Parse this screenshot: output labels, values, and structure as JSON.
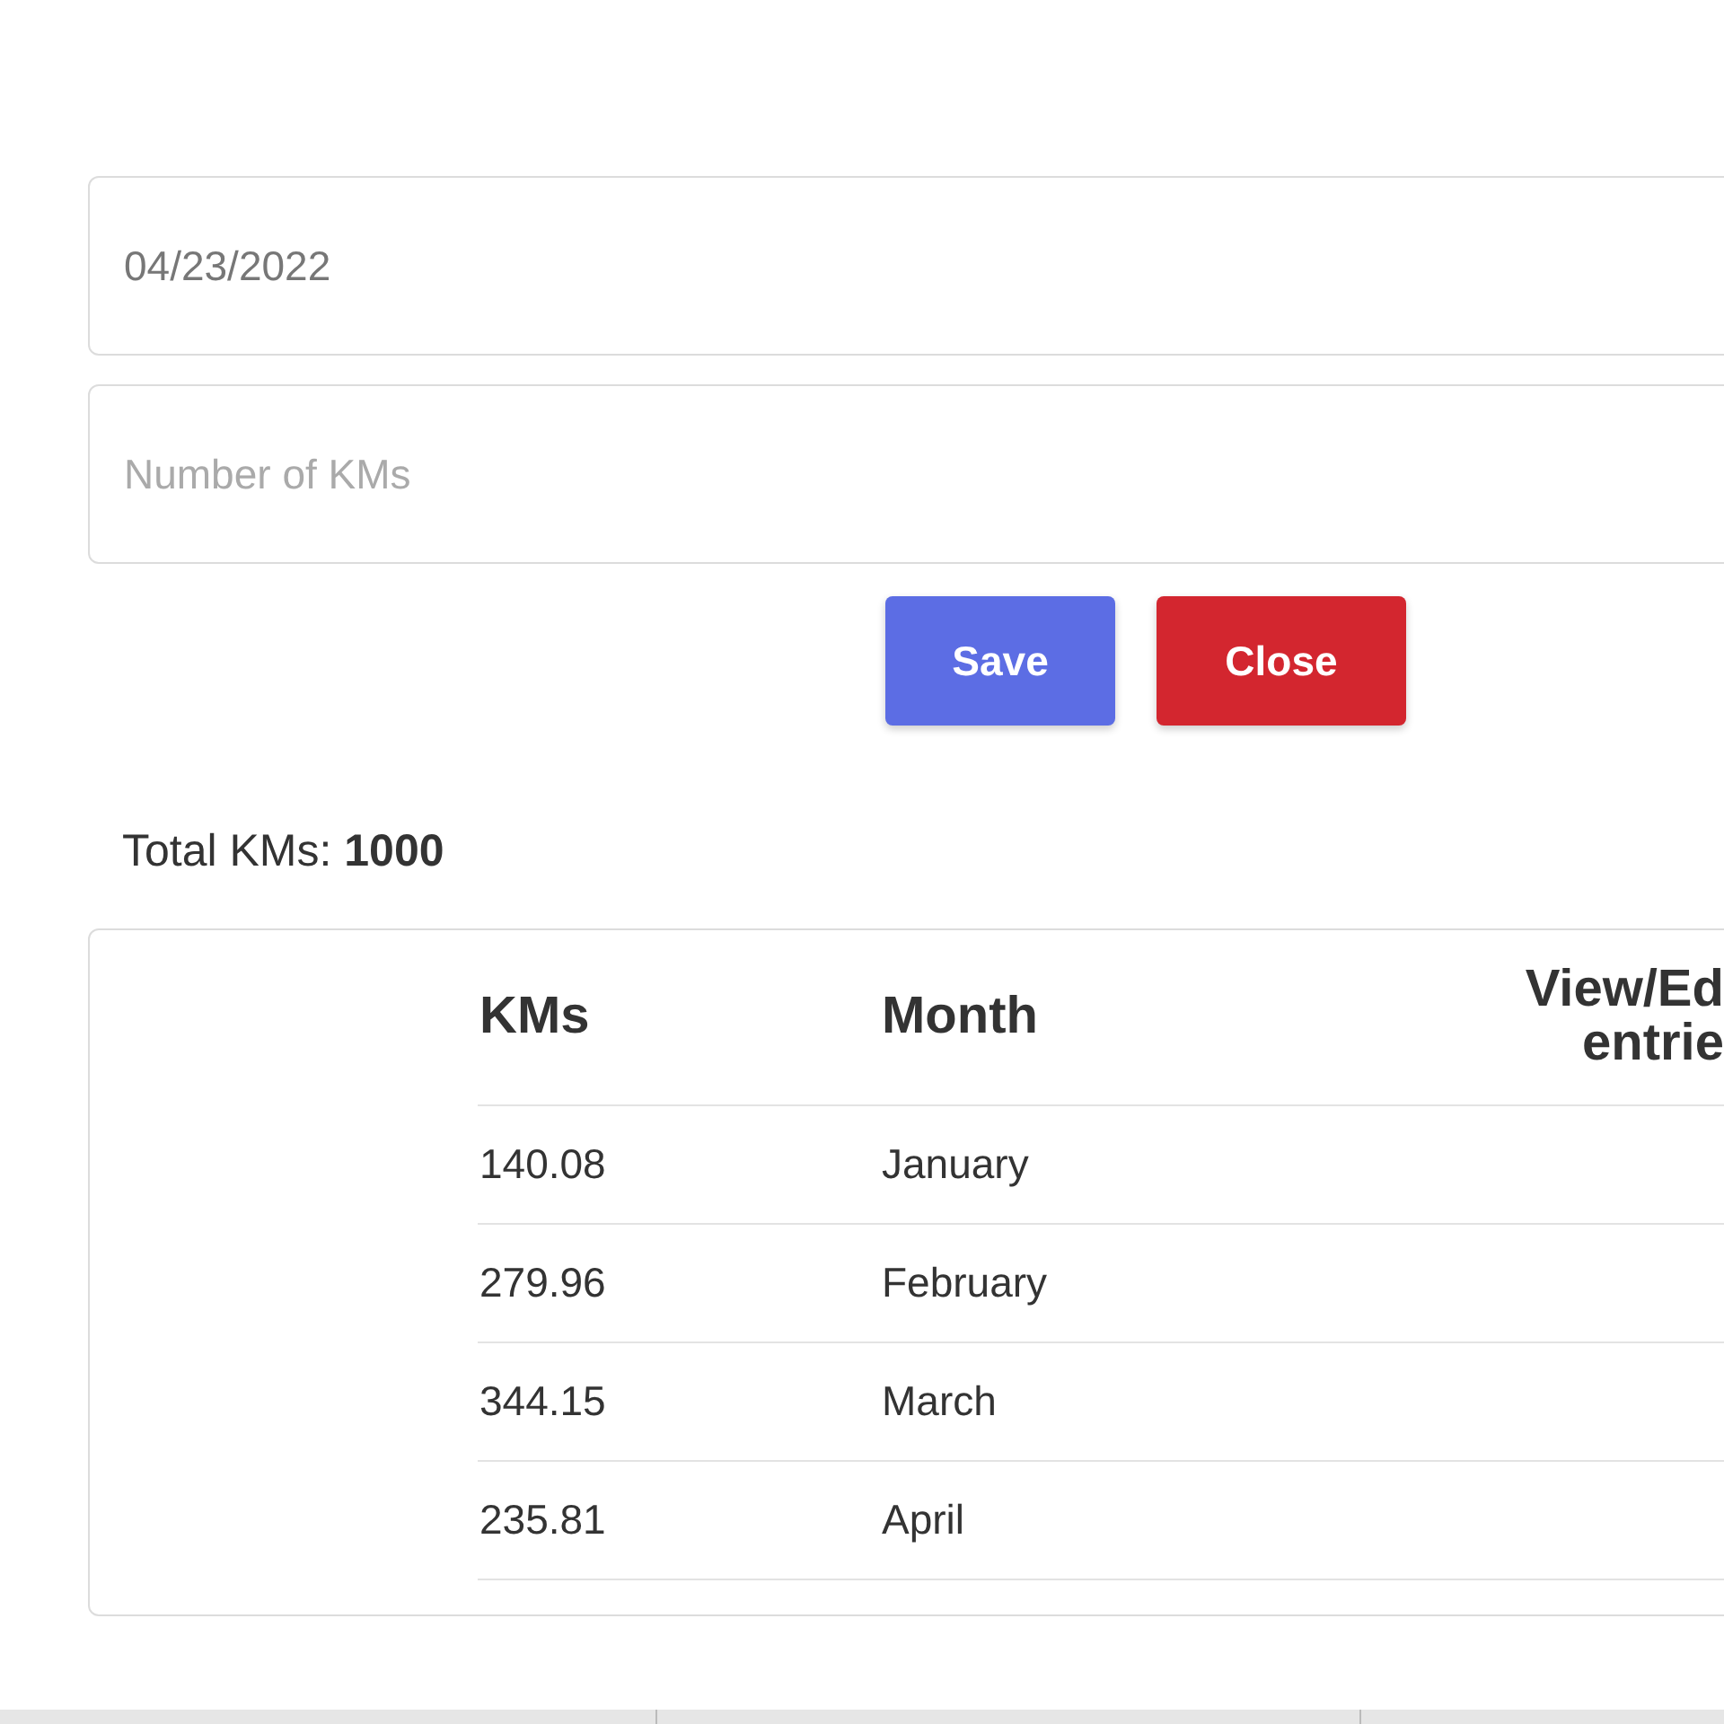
{
  "form": {
    "date_field": {
      "value": "04/23/2022"
    },
    "kms_field": {
      "placeholder": "Number of KMs"
    },
    "buttons": [
      {
        "label": "Save",
        "kind": "primary"
      },
      {
        "label": "Close",
        "kind": "danger"
      }
    ]
  },
  "total": "Total KMs: **1000**",
  "table": {
    "columns": [
      "KMs",
      "Month",
      "View/Ed\nentrie"
    ],
    "rows": [
      [
        "140.08",
        "January"
      ],
      [
        "279.96",
        "February"
      ],
      [
        "344.15",
        "March"
      ],
      [
        "235.81",
        "April"
      ]
    ]
  }
}
